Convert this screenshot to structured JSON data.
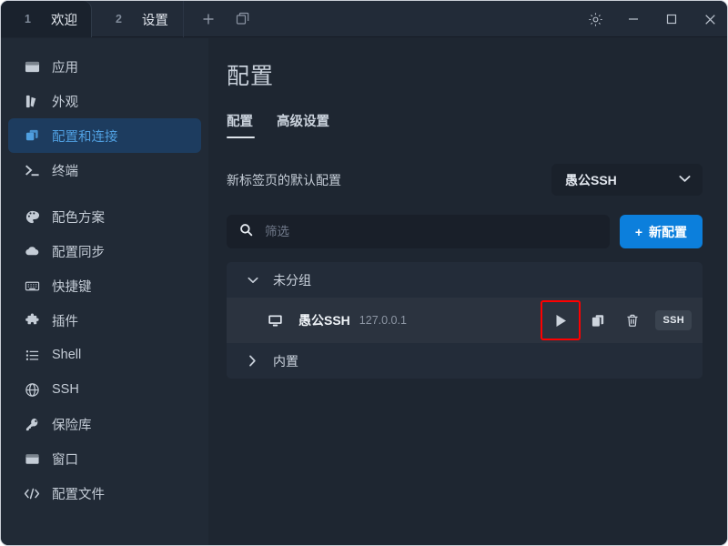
{
  "window": {
    "tabs": [
      {
        "index": "1",
        "title": "欢迎",
        "active": true
      },
      {
        "index": "2",
        "title": "设置",
        "active": false
      }
    ],
    "tabbar_actions": [
      {
        "name": "new-tab-button",
        "label": "+"
      },
      {
        "name": "tab-manager-button",
        "label": "windows"
      }
    ],
    "controls": [
      {
        "name": "settings-button",
        "label": "gear-icon"
      },
      {
        "name": "minimize-button",
        "label": "–"
      },
      {
        "name": "maximize-button",
        "label": "□"
      },
      {
        "name": "close-button",
        "label": "✕"
      }
    ]
  },
  "sidebar": {
    "items": [
      {
        "label": "应用",
        "icon": "app-window-icon",
        "active": false
      },
      {
        "label": "外观",
        "icon": "appearance-icon",
        "active": false
      },
      {
        "label": "配置和连接",
        "icon": "profiles-connections-icon",
        "active": true
      },
      {
        "label": "终端",
        "icon": "terminal-icon",
        "active": false
      },
      {
        "label": "配色方案",
        "icon": "palette-icon",
        "active": false
      },
      {
        "label": "配置同步",
        "icon": "cloud-sync-icon",
        "active": false
      },
      {
        "label": "快捷键",
        "icon": "keyboard-icon",
        "active": false
      },
      {
        "label": "插件",
        "icon": "puzzle-plugin-icon",
        "active": false
      },
      {
        "label": "Shell",
        "icon": "list-shell-icon",
        "active": false
      },
      {
        "label": "SSH",
        "icon": "globe-ssh-icon",
        "active": false
      },
      {
        "label": "保险库",
        "icon": "key-vault-icon",
        "active": false
      },
      {
        "label": "窗口",
        "icon": "window-icon",
        "active": false
      },
      {
        "label": "配置文件",
        "icon": "code-file-icon",
        "active": false
      }
    ]
  },
  "main": {
    "title": "配置",
    "subtabs": [
      {
        "label": "配置",
        "active": true
      },
      {
        "label": "高级设置",
        "active": false
      }
    ],
    "default_profile": {
      "label": "新标签页的默认配置",
      "selected": "愚公SSH"
    },
    "search": {
      "placeholder": "筛选",
      "value": ""
    },
    "new_button": {
      "plus": "+",
      "label": "新配置"
    },
    "groups": [
      {
        "name": "未分组",
        "expanded": true,
        "arrow": "∨",
        "items": [
          {
            "name": "愚公SSH",
            "host": "127.0.0.1",
            "badge": "SSH",
            "icon": "monitor-icon",
            "actions": [
              {
                "name": "launch-button",
                "icon": "play-icon",
                "highlighted": true
              },
              {
                "name": "duplicate-button",
                "icon": "copy-icon",
                "highlighted": false
              },
              {
                "name": "delete-button",
                "icon": "trash-icon",
                "highlighted": false
              }
            ]
          }
        ]
      },
      {
        "name": "内置",
        "expanded": false,
        "arrow": "›",
        "items": []
      }
    ]
  },
  "colors": {
    "accent_blue": "#0c7fdc",
    "sidebar_active_bg": "#1d3c5f",
    "sidebar_active_text": "#4f9fe0",
    "highlight_red": "#ff0000",
    "window_bg": "#1e2631",
    "sidebar_bg": "#212a36",
    "row_bg": "#2b333f"
  }
}
